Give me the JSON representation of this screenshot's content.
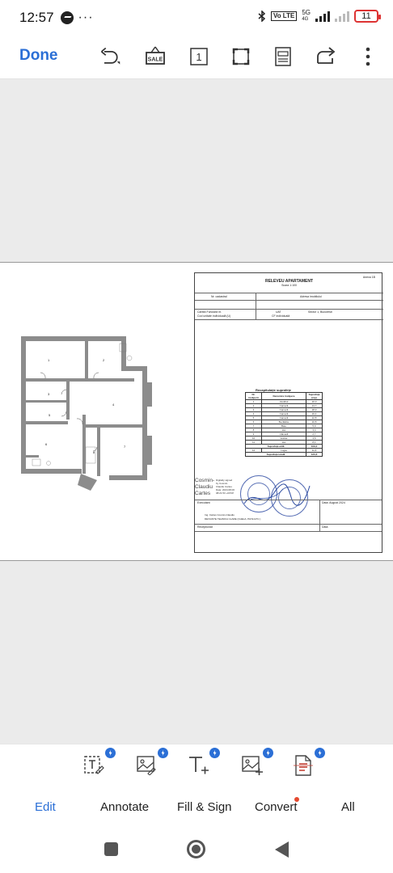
{
  "status_bar": {
    "time": "12:57",
    "dots": "···",
    "network_gen": "5G",
    "network_sub": "4G",
    "volte": "Vo LTE",
    "battery": "11"
  },
  "toolbar": {
    "done_label": "Done",
    "sale_label": "SALE",
    "page_number": "1"
  },
  "document": {
    "annex": "Anexa 1B",
    "title": "RELEVEU APARTAMENT",
    "scale": "Scara 1:100",
    "header": {
      "nr_cadastral_label": "Nr. cadastral",
      "adresa_label": "Adresa imobilului",
      "carte_funciara_label": "Cartea Funciară nr.",
      "uat_label": "UAT",
      "uat_value": "Sector 1, București",
      "cod_unitate_label": "Cod unitate individuală (U)",
      "cf_label": "CF individuală"
    },
    "room_numbers": [
      "1",
      "2",
      "3",
      "4",
      "5",
      "6",
      "7",
      "8"
    ],
    "summary": {
      "title": "Recapitulație suprafețe",
      "col_nr": "Nr. încăperii",
      "col_name": "Denumire încăpere",
      "col_area": "Suprafața (mp)",
      "rows": [
        {
          "nr": "1",
          "name": "Vestibul",
          "area": "10,3"
        },
        {
          "nr": "2",
          "name": "Cameră",
          "area": "14,7"
        },
        {
          "nr": "3",
          "name": "Cameră",
          "area": "18,9"
        },
        {
          "nr": "4",
          "name": "Cameră",
          "area": "16,4"
        },
        {
          "nr": "5",
          "name": "Cameră",
          "area": "12,8"
        },
        {
          "nr": "6",
          "name": "Bucătărie",
          "area": "10,8"
        },
        {
          "nr": "7",
          "name": "Baie",
          "area": "5,0"
        },
        {
          "nr": "8",
          "name": "Hol",
          "area": "3,4"
        },
        {
          "nr": "9",
          "name": "Cămară",
          "area": "2,7"
        },
        {
          "nr": "10",
          "name": "Vestiar",
          "area": "3,6"
        },
        {
          "nr": "11",
          "name": "Hol",
          "area": "8,1"
        }
      ],
      "useful_label": "Suprafața utilă",
      "useful_value": "109,0",
      "loggia_nr": "12",
      "loggia_name": "Logia",
      "loggia_area": "11,6",
      "total_label": "Suprafața totală",
      "total_value": "120,6"
    },
    "signer": {
      "name_lines": [
        "Cosmin-",
        "Claudiu",
        "Cartes"
      ],
      "info_lines": [
        "Digitally signed",
        "by Cosmin-",
        "Claudiu Cartes",
        "Date: 2024.08.06",
        "08:21:53 +03'00'"
      ]
    },
    "footer": {
      "executant_label": "Executant",
      "date_label": "Data: August 2024",
      "engineer_line1": "Ing. Cartes Cosmin-Claudiu",
      "engineer_line2": "DEVIANTE TEHNICA CLARE (CHELA, PAYE ETC.)",
      "receptionat_label": "Recepționat",
      "data_label": "Data"
    }
  },
  "bottom_tools": {
    "items": [
      "edit-text",
      "edit-image",
      "add-text",
      "add-image",
      "ocr"
    ]
  },
  "tabs": [
    {
      "label": "Edit",
      "active": true
    },
    {
      "label": "Annotate",
      "active": false
    },
    {
      "label": "Fill & Sign",
      "active": false
    },
    {
      "label": "Convert",
      "active": false,
      "badge": true
    },
    {
      "label": "All",
      "active": false
    }
  ],
  "colors": {
    "accent": "#2b6fd6",
    "canvas_bg": "#ebebeb",
    "stamp": "#3a55a8",
    "notification": "#e5492f"
  }
}
